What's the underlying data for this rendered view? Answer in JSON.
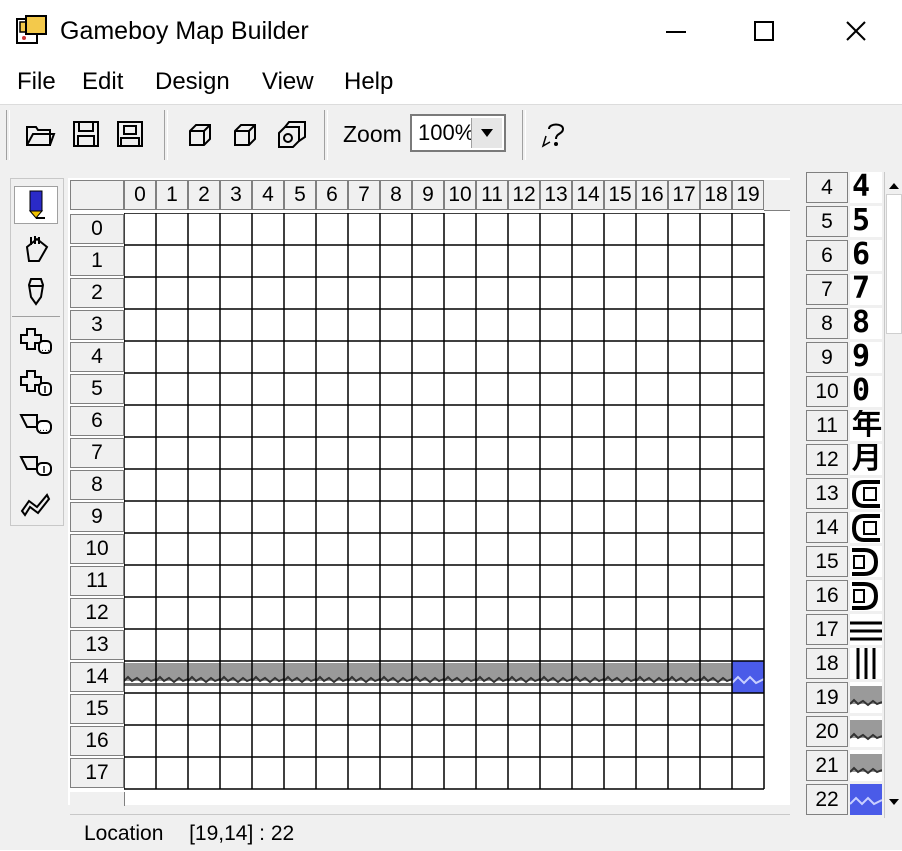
{
  "window": {
    "title": "Gameboy Map Builder",
    "minimize_icon": "minimize-icon",
    "maximize_icon": "maximize-icon",
    "close_icon": "close-icon"
  },
  "menu": [
    "File",
    "Edit",
    "Design",
    "View",
    "Help"
  ],
  "toolbar": {
    "buttons": [
      "open-icon",
      "save-icon",
      "save-as-icon",
      "copy-layer-icon",
      "paste-layer-icon",
      "layers-icon"
    ],
    "zoom_label": "Zoom",
    "zoom_value": "100%",
    "help_icon": "help-icon"
  },
  "tools": [
    "pencil-tool-icon",
    "bucket-tool-icon",
    "dropper-tool-icon",
    "insert-column-icon",
    "insert-row-icon",
    "delete-column-icon",
    "delete-row-icon",
    "properties-icon"
  ],
  "map": {
    "columns": [
      "0",
      "1",
      "2",
      "3",
      "4",
      "5",
      "6",
      "7",
      "8",
      "9",
      "10",
      "11",
      "12",
      "13",
      "14",
      "15",
      "16",
      "17",
      "18",
      "19"
    ],
    "rows": [
      "0",
      "1",
      "2",
      "3",
      "4",
      "5",
      "6",
      "7",
      "8",
      "9",
      "10",
      "11",
      "12",
      "13",
      "14",
      "15",
      "16",
      "17"
    ],
    "ground_row": 14,
    "water_col": 19,
    "colors": {
      "ground": "#9a9a9a",
      "water": "#4a5be8",
      "grid": "#000000"
    }
  },
  "status": {
    "label": "Location",
    "value": "[19,14] : 22"
  },
  "palette": {
    "numbers": [
      "4",
      "5",
      "6",
      "7",
      "8",
      "9",
      "10",
      "11",
      "12",
      "13",
      "14",
      "15",
      "16",
      "17",
      "18",
      "19",
      "20",
      "21",
      "22"
    ],
    "glyphs": [
      "4",
      "5",
      "6",
      "7",
      "8",
      "9",
      "0",
      "年",
      "月",
      "",
      "",
      "",
      "",
      "",
      "",
      "",
      "",
      "",
      ""
    ]
  }
}
